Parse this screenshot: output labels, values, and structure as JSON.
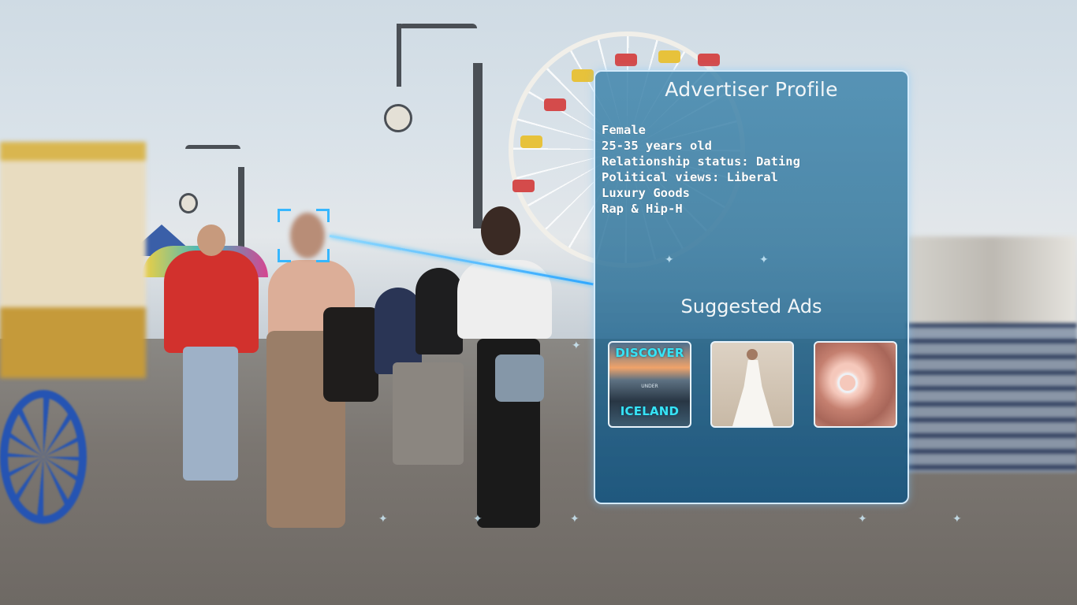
{
  "panel": {
    "title": "Advertiser Profile",
    "profile_lines": [
      "Female",
      "25-35 years old",
      "Relationship status: Dating",
      "Political views: Liberal",
      "Luxury Goods",
      "Rap & Hip-H"
    ],
    "suggested_ads_title": "Suggested Ads",
    "ads": [
      {
        "name": "iceland",
        "top_text": "DISCOVER",
        "mid_text": "UNDER",
        "bottom_text": "ICELAND"
      },
      {
        "name": "wedding-dress"
      },
      {
        "name": "ring"
      }
    ]
  },
  "overlay": {
    "accent_color": "#37b7ff",
    "ad_text_color": "#37e3f5",
    "icons": [
      "face-detection-frame-icon",
      "sparkle-icon"
    ]
  }
}
